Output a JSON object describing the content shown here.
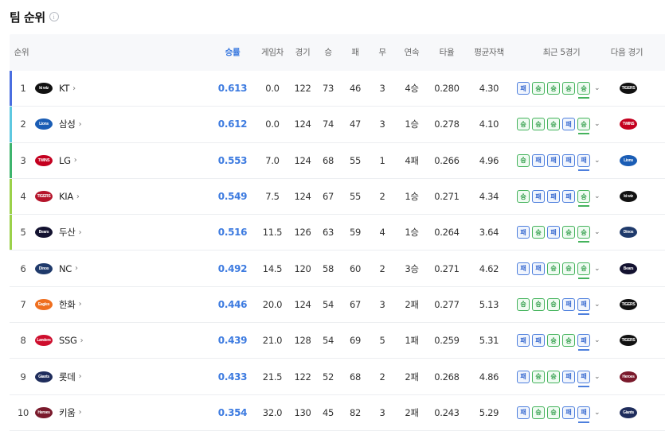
{
  "header": {
    "title": "팀 순위",
    "info_icon": "info-icon"
  },
  "columns": [
    "순위",
    "승률",
    "게임차",
    "경기",
    "승",
    "패",
    "무",
    "연속",
    "타율",
    "평균자책",
    "최근 5경기",
    "다음 경기"
  ],
  "recent_labels": {
    "W": "승",
    "L": "패"
  },
  "colors": {
    "accent": "#3d7be0",
    "win": "#44b35c",
    "loss": "#4d7fdd"
  },
  "rows": [
    {
      "rank": "1",
      "team": "KT",
      "logo_color": "#111111",
      "logo_text": "kt wiz",
      "bar": "#4a6ee0",
      "winrate": "0.613",
      "gb": "0.0",
      "games": "122",
      "w": "73",
      "l": "46",
      "d": "3",
      "streak": "4승",
      "avg": "0.280",
      "era": "4.30",
      "recent": [
        "L",
        "W",
        "W",
        "W",
        "W"
      ],
      "next_color": "#111111",
      "next_text": "TIGERS"
    },
    {
      "rank": "2",
      "team": "삼성",
      "logo_color": "#1a5db5",
      "logo_text": "Lions",
      "bar": "#5ec8e0",
      "winrate": "0.612",
      "gb": "0.0",
      "games": "124",
      "w": "74",
      "l": "47",
      "d": "3",
      "streak": "1승",
      "avg": "0.278",
      "era": "4.10",
      "recent": [
        "W",
        "W",
        "W",
        "L",
        "W"
      ],
      "next_color": "#c4001f",
      "next_text": "TWINS"
    },
    {
      "rank": "3",
      "team": "LG",
      "logo_color": "#c4001f",
      "logo_text": "TWINS",
      "bar": "#3db46d",
      "winrate": "0.553",
      "gb": "7.0",
      "games": "124",
      "w": "68",
      "l": "55",
      "d": "1",
      "streak": "4패",
      "avg": "0.266",
      "era": "4.96",
      "recent": [
        "W",
        "L",
        "L",
        "L",
        "L"
      ],
      "next_color": "#1a5db5",
      "next_text": "Lions"
    },
    {
      "rank": "4",
      "team": "KIA",
      "logo_color": "#b5152b",
      "logo_text": "TIGERS",
      "bar": "#9bd14a",
      "winrate": "0.549",
      "gb": "7.5",
      "games": "124",
      "w": "67",
      "l": "55",
      "d": "2",
      "streak": "1승",
      "avg": "0.271",
      "era": "4.34",
      "recent": [
        "W",
        "L",
        "L",
        "L",
        "W"
      ],
      "next_color": "#111111",
      "next_text": "kt wiz"
    },
    {
      "rank": "5",
      "team": "두산",
      "logo_color": "#131230",
      "logo_text": "Bears",
      "bar": "#9bd14a",
      "winrate": "0.516",
      "gb": "11.5",
      "games": "126",
      "w": "63",
      "l": "59",
      "d": "4",
      "streak": "1승",
      "avg": "0.264",
      "era": "3.64",
      "recent": [
        "L",
        "W",
        "L",
        "W",
        "W"
      ],
      "next_color": "#1f3a6b",
      "next_text": "Dinos"
    },
    {
      "rank": "6",
      "team": "NC",
      "logo_color": "#1f3a6b",
      "logo_text": "Dinos",
      "bar": "",
      "winrate": "0.492",
      "gb": "14.5",
      "games": "120",
      "w": "58",
      "l": "60",
      "d": "2",
      "streak": "3승",
      "avg": "0.271",
      "era": "4.62",
      "recent": [
        "L",
        "L",
        "W",
        "W",
        "W"
      ],
      "next_color": "#131230",
      "next_text": "Bears"
    },
    {
      "rank": "7",
      "team": "한화",
      "logo_color": "#ef6f1f",
      "logo_text": "Eagles",
      "bar": "",
      "winrate": "0.446",
      "gb": "20.0",
      "games": "124",
      "w": "54",
      "l": "67",
      "d": "3",
      "streak": "2패",
      "avg": "0.277",
      "era": "5.13",
      "recent": [
        "W",
        "W",
        "W",
        "L",
        "L"
      ],
      "next_color": "#111111",
      "next_text": "TIGERS"
    },
    {
      "rank": "8",
      "team": "SSG",
      "logo_color": "#ce0e2d",
      "logo_text": "Landers",
      "bar": "",
      "winrate": "0.439",
      "gb": "21.0",
      "games": "128",
      "w": "54",
      "l": "69",
      "d": "5",
      "streak": "1패",
      "avg": "0.259",
      "era": "5.31",
      "recent": [
        "L",
        "L",
        "W",
        "W",
        "L"
      ],
      "next_color": "#111111",
      "next_text": "TIGERS"
    },
    {
      "rank": "9",
      "team": "롯데",
      "logo_color": "#1f2d5c",
      "logo_text": "Giants",
      "bar": "",
      "winrate": "0.433",
      "gb": "21.5",
      "games": "122",
      "w": "52",
      "l": "68",
      "d": "2",
      "streak": "2패",
      "avg": "0.268",
      "era": "4.86",
      "recent": [
        "L",
        "W",
        "W",
        "L",
        "L"
      ],
      "next_color": "#7a1a2c",
      "next_text": "Heroes"
    },
    {
      "rank": "10",
      "team": "키움",
      "logo_color": "#7a1a2c",
      "logo_text": "Heroes",
      "bar": "",
      "winrate": "0.354",
      "gb": "32.0",
      "games": "130",
      "w": "45",
      "l": "82",
      "d": "3",
      "streak": "2패",
      "avg": "0.243",
      "era": "5.29",
      "recent": [
        "L",
        "W",
        "W",
        "L",
        "L"
      ],
      "next_color": "#1f2d5c",
      "next_text": "Giants"
    }
  ]
}
